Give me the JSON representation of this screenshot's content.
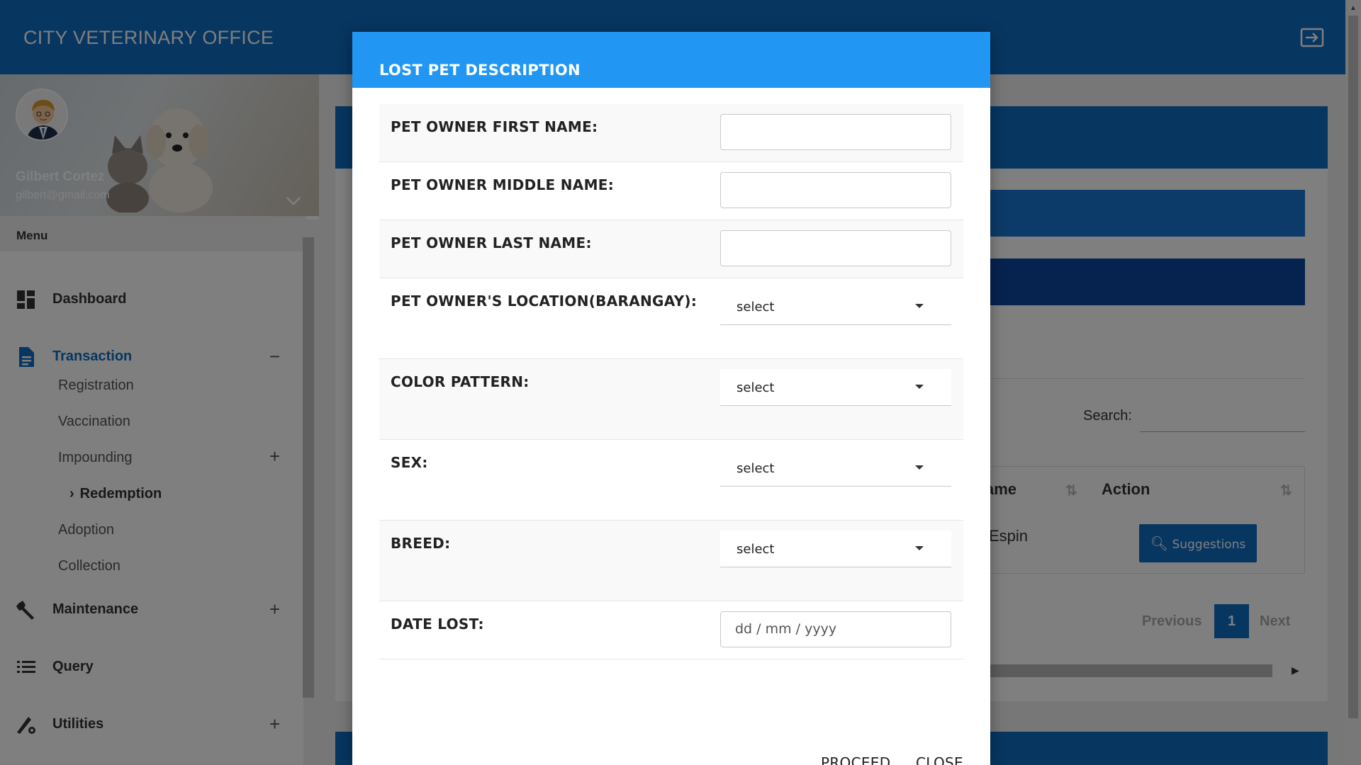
{
  "app": {
    "brand": "CITY VETERINARY OFFICE",
    "user": {
      "name": "Gilbert Cortez",
      "email": "gilbert@gmail.com"
    }
  },
  "colors": {
    "primary": "#0f6cc2",
    "modal_header": "#2196f3",
    "dark_bar": "#0d47a1"
  },
  "sidebar": {
    "menu_title": "Menu",
    "items": [
      {
        "label": "Dashboard",
        "icon": "dashboard-icon"
      },
      {
        "label": "Transaction",
        "icon": "document-icon",
        "toggle": "−"
      },
      {
        "label": "Maintenance",
        "icon": "wrench-icon",
        "toggle": "+"
      },
      {
        "label": "Query",
        "icon": "list-icon"
      },
      {
        "label": "Utilities",
        "icon": "gear-pen-icon",
        "toggle": "+"
      }
    ],
    "subitems": [
      {
        "label": "Registration"
      },
      {
        "label": "Vaccination"
      },
      {
        "label": "Impounding",
        "toggle": "+"
      },
      {
        "label": "Redemption",
        "prefix": "›"
      },
      {
        "label": "Adoption"
      },
      {
        "label": "Collection"
      }
    ]
  },
  "table": {
    "search_label": "Search:",
    "columns": [
      "ame",
      "Action"
    ],
    "row": {
      "name_partial": "Espin",
      "action_label": "Suggestions"
    },
    "pagination": {
      "previous": "Previous",
      "current": "1",
      "next": "Next"
    }
  },
  "modal": {
    "title": "LOST PET DESCRIPTION",
    "fields": [
      {
        "label": "PET OWNER FIRST NAME:",
        "type": "text",
        "value": ""
      },
      {
        "label": "PET OWNER MIDDLE NAME:",
        "type": "text",
        "value": ""
      },
      {
        "label": "PET OWNER LAST NAME:",
        "type": "text",
        "value": ""
      },
      {
        "label": "PET OWNER'S LOCATION(BARANGAY):",
        "type": "select",
        "value": "select"
      },
      {
        "label": "COLOR PATTERN:",
        "type": "select",
        "value": "select"
      },
      {
        "label": "SEX:",
        "type": "select",
        "value": "select"
      },
      {
        "label": "BREED:",
        "type": "select",
        "value": "select"
      },
      {
        "label": "DATE LOST:",
        "type": "date",
        "placeholder": "dd / mm / yyyy"
      }
    ],
    "buttons": {
      "proceed": "PROCEED",
      "close": "CLOSE"
    }
  }
}
